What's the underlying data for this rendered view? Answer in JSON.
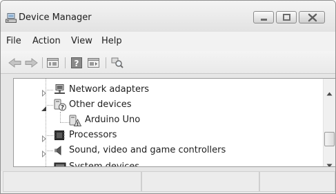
{
  "window": {
    "title": "Device Manager"
  },
  "menu": {
    "items": [
      "File",
      "Action",
      "View",
      "Help"
    ]
  },
  "toolbar": {
    "icons": [
      "back-arrow-icon",
      "forward-arrow-icon",
      "properties-view-icon",
      "help-icon",
      "console-tree-icon",
      "scan-hardware-icon"
    ]
  },
  "tree": {
    "items": [
      {
        "label": "Network adapters",
        "icon": "network-adapter-icon",
        "expander": "collapsed"
      },
      {
        "label": "Other devices",
        "icon": "unknown-device-icon",
        "expander": "expanded"
      },
      {
        "label": "Arduino Uno",
        "icon": "unknown-device-icon",
        "expander": "none"
      },
      {
        "label": "Processors",
        "icon": "processor-icon",
        "expander": "collapsed"
      },
      {
        "label": "Sound, video and game controllers",
        "icon": "speaker-icon",
        "expander": "collapsed"
      },
      {
        "label": "System devices",
        "icon": "system-device-icon",
        "expander": "collapsed"
      }
    ]
  },
  "colors": {
    "window_bg": "#e6e6e6",
    "tree_bg": "#ffffff",
    "text": "#1e1e1e"
  }
}
